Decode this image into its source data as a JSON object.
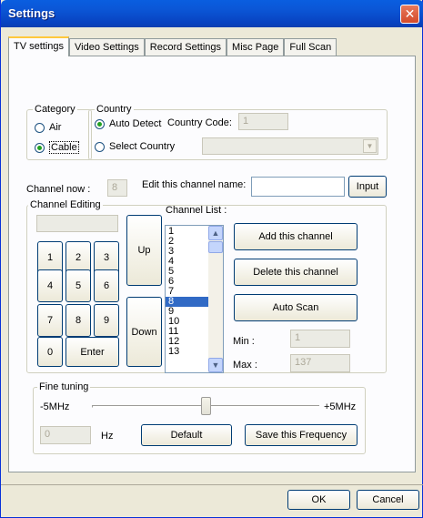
{
  "window": {
    "title": "Settings"
  },
  "tabs": [
    "TV settings",
    "Video Settings",
    "Record Settings",
    "Misc Page",
    "Full Scan"
  ],
  "category": {
    "legend": "Category",
    "options": [
      "Air",
      "Cable"
    ],
    "selected": "Cable"
  },
  "country": {
    "legend": "Country",
    "auto_detect": "Auto Detect",
    "select_country": "Select Country",
    "code_label": "Country Code:",
    "code_value": "1",
    "selected": "Auto Detect"
  },
  "channel_now": {
    "label": "Channel now :",
    "value": "8"
  },
  "edit_name": {
    "label": "Edit this channel name:",
    "value": "",
    "input_button": "Input"
  },
  "channel_editing": {
    "legend": "Channel Editing",
    "keys": [
      "1",
      "2",
      "3",
      "4",
      "5",
      "6",
      "7",
      "8",
      "9",
      "0",
      "Enter"
    ],
    "up": "Up",
    "down": "Down"
  },
  "channel_list": {
    "label": "Channel List :",
    "items": [
      "1",
      "2",
      "3",
      "4",
      "5",
      "6",
      "7",
      "8",
      "9",
      "10",
      "11",
      "12",
      "13"
    ],
    "selected": "8"
  },
  "actions": {
    "add": "Add this channel",
    "delete": "Delete this channel",
    "scan": "Auto Scan"
  },
  "range": {
    "min_label": "Min :",
    "min_value": "1",
    "max_label": "Max :",
    "max_value": "137"
  },
  "fine_tuning": {
    "legend": "Fine tuning",
    "min_label": "-5MHz",
    "max_label": "+5MHz",
    "level": 0.5,
    "hz_value": "0",
    "hz_unit": "Hz",
    "default_button": "Default",
    "save_button": "Save this Frequency"
  },
  "footer": {
    "ok": "OK",
    "cancel": "Cancel"
  }
}
